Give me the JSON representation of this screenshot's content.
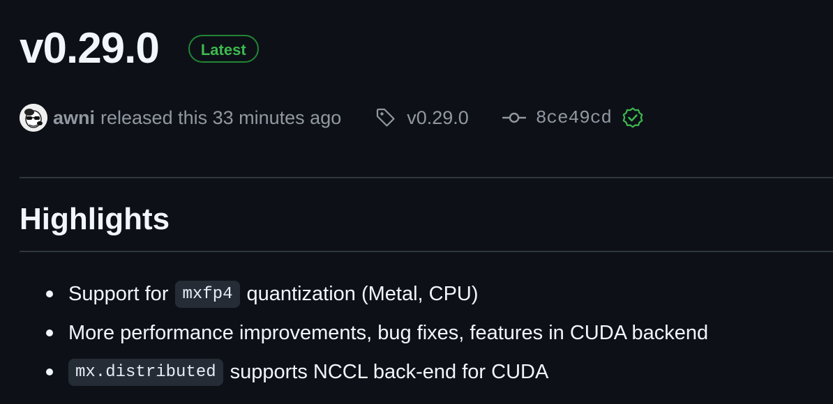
{
  "release": {
    "title": "v0.29.0",
    "badge": "Latest"
  },
  "meta": {
    "author": "awni",
    "released_text": "released this 33 minutes ago",
    "tag": "v0.29.0",
    "commit": "8ce49cd"
  },
  "highlights": {
    "heading": "Highlights",
    "items": [
      {
        "pre": "Support for",
        "code": "mxfp4",
        "post": "quantization (Metal, CPU)"
      },
      {
        "text": "More performance improvements, bug fixes, features in CUDA backend"
      },
      {
        "code": "mx.distributed",
        "post": "supports NCCL back-end for CUDA"
      }
    ]
  },
  "colors": {
    "background": "#0d1117",
    "latest_badge": "#3fb950",
    "verified": "#3fb950",
    "muted_text": "#9198a1",
    "divider": "#30363d"
  },
  "icons": [
    "avatar",
    "tag-icon",
    "git-commit-icon",
    "verified-check-icon"
  ]
}
